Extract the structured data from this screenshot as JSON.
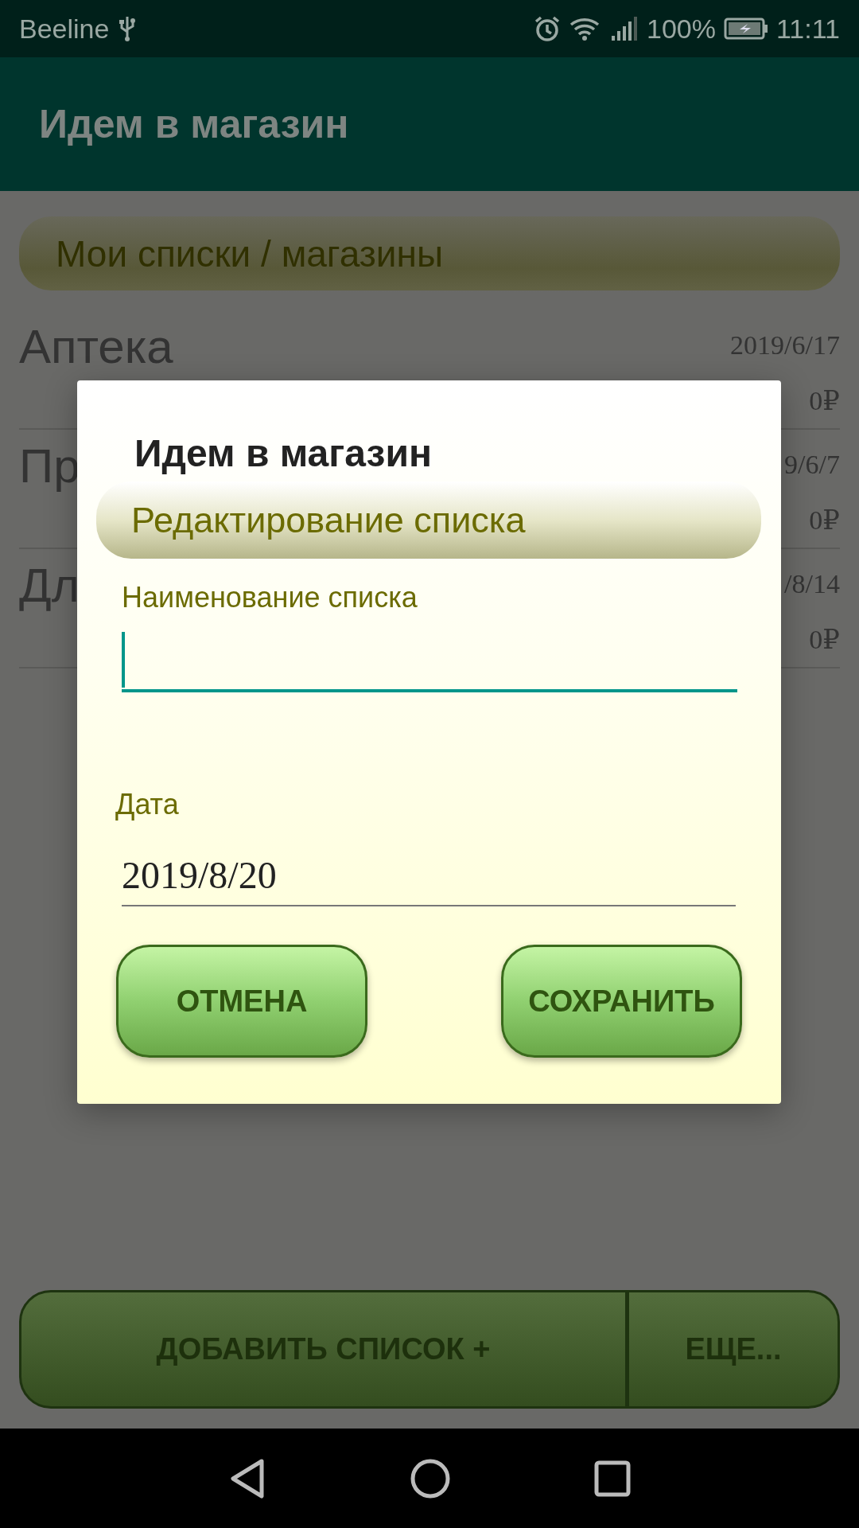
{
  "status_bar": {
    "carrier": "Beeline",
    "battery": "100%",
    "time": "11:11"
  },
  "app_bar": {
    "title": "Идем в магазин"
  },
  "section_header": "Мои списки / магазины",
  "lists": [
    {
      "name": "Аптека",
      "date": "2019/6/17",
      "total": "0₽"
    },
    {
      "name": "Пр",
      "date": "9/6/7",
      "total": "0₽"
    },
    {
      "name": "Дл",
      "date": "/8/14",
      "total": "0₽"
    }
  ],
  "bottom_buttons": [
    "ДОБАВИТЬ СПИСОК +",
    "ЕЩЕ..."
  ],
  "dialog": {
    "title": "Идем в магазин",
    "subtitle": "Редактирование списка",
    "name_field": {
      "label": "Наименование списка",
      "focused": true
    },
    "date_field": {
      "label": "Дата",
      "value": "2019/8/20"
    },
    "buttons": [
      "ОТМЕНА",
      "СОХРАНИТЬ"
    ]
  }
}
